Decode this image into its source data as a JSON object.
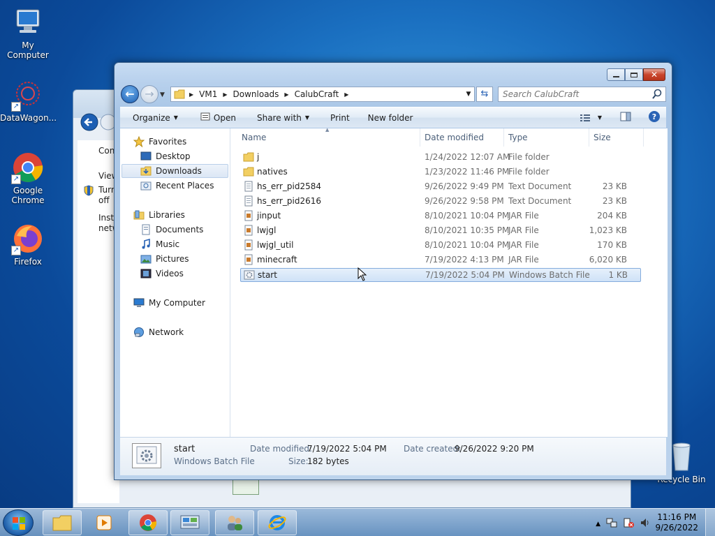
{
  "desktop": {
    "icons": [
      {
        "label": "My Computer"
      },
      {
        "label": "DataWagon..."
      },
      {
        "label": "Google Chrome"
      },
      {
        "label": "Firefox"
      },
      {
        "label": "Recycle Bin"
      }
    ]
  },
  "background_window": {
    "text1": "Con",
    "text2": "View",
    "text3": "Turn off",
    "text4": "Insta netw"
  },
  "window": {
    "address": [
      "VM1",
      "Downloads",
      "CalubCraft"
    ],
    "search_placeholder": "Search CalubCraft"
  },
  "toolbar": {
    "organize": "Organize",
    "open": "Open",
    "share_with": "Share with",
    "print": "Print",
    "new_folder": "New folder"
  },
  "navpane": {
    "favorites": "Favorites",
    "desktop": "Desktop",
    "downloads": "Downloads",
    "recent_places": "Recent Places",
    "libraries": "Libraries",
    "documents": "Documents",
    "music": "Music",
    "pictures": "Pictures",
    "videos": "Videos",
    "my_computer": "My Computer",
    "network": "Network"
  },
  "columns": {
    "name": "Name",
    "date_modified": "Date modified",
    "type": "Type",
    "size": "Size"
  },
  "files": [
    {
      "name": "j",
      "date": "1/24/2022 12:07 AM",
      "type": "File folder",
      "size": "",
      "kind": "folder"
    },
    {
      "name": "natives",
      "date": "1/23/2022 11:46 PM",
      "type": "File folder",
      "size": "",
      "kind": "folder"
    },
    {
      "name": "hs_err_pid2584",
      "date": "9/26/2022 9:49 PM",
      "type": "Text Document",
      "size": "23 KB",
      "kind": "text"
    },
    {
      "name": "hs_err_pid2616",
      "date": "9/26/2022 9:58 PM",
      "type": "Text Document",
      "size": "23 KB",
      "kind": "text"
    },
    {
      "name": "jinput",
      "date": "8/10/2021 10:04 PM",
      "type": "JAR File",
      "size": "204 KB",
      "kind": "jar"
    },
    {
      "name": "lwjgl",
      "date": "8/10/2021 10:35 PM",
      "type": "JAR File",
      "size": "1,023 KB",
      "kind": "jar"
    },
    {
      "name": "lwjgl_util",
      "date": "8/10/2021 10:04 PM",
      "type": "JAR File",
      "size": "170 KB",
      "kind": "jar"
    },
    {
      "name": "minecraft",
      "date": "7/19/2022 4:13 PM",
      "type": "JAR File",
      "size": "6,020 KB",
      "kind": "jar"
    },
    {
      "name": "start",
      "date": "7/19/2022 5:04 PM",
      "type": "Windows Batch File",
      "size": "1 KB",
      "kind": "bat",
      "selected": true
    }
  ],
  "details": {
    "name": "start",
    "type": "Windows Batch File",
    "date_modified_label": "Date modified:",
    "date_modified": "7/19/2022 5:04 PM",
    "size_label": "Size:",
    "size": "182 bytes",
    "date_created_label": "Date created:",
    "date_created": "9/26/2022 9:20 PM"
  },
  "taskbar": {
    "time": "11:16 PM",
    "date": "9/26/2022"
  },
  "colors": {
    "accent": "#1d5fb3",
    "selection": "#cfe2f7"
  }
}
